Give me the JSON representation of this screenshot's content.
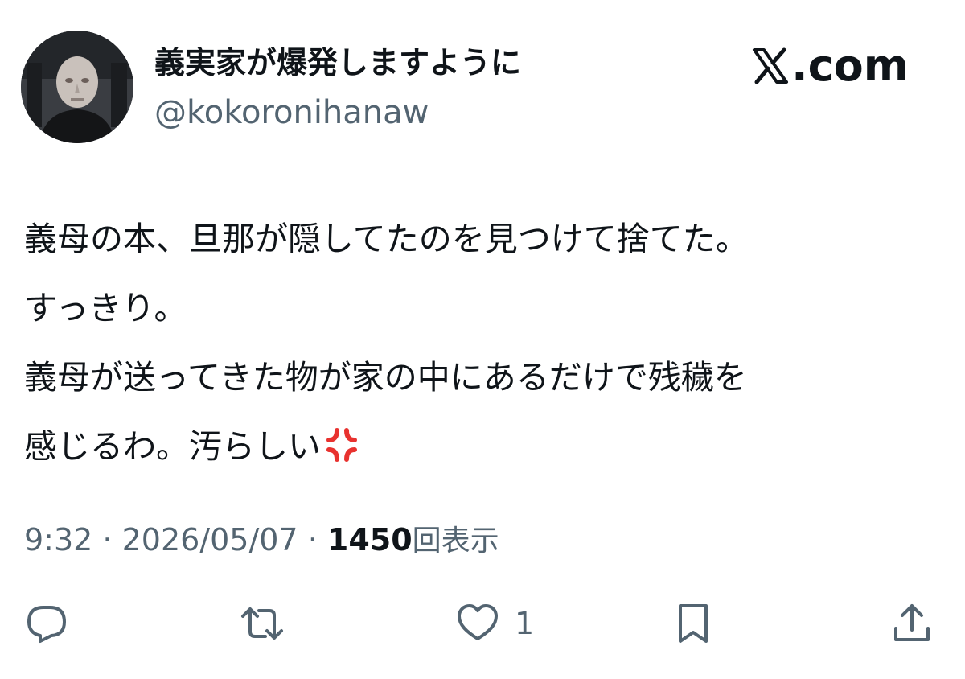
{
  "header": {
    "display_name": "義実家が爆発しますように",
    "handle": "@kokoronihanaw",
    "brand": ".com",
    "brand_icon": "x-logo"
  },
  "tweet": {
    "lines": [
      "義母の本、旦那が隠してたのを見つけて捨てた。",
      "すっきり。",
      "義母が送ってきた物が家の中にあるだけで残穢を",
      "感じるわ。汚らしい"
    ],
    "emoji": "anger-symbol"
  },
  "meta": {
    "time": "9:32",
    "separator": " · ",
    "date": "2026/05/07",
    "views_count": "1450",
    "views_label": "回表示"
  },
  "actions": {
    "reply_icon": "reply-icon",
    "repost_icon": "repost-icon",
    "like_icon": "heart-icon",
    "like_count": "1",
    "bookmark_icon": "bookmark-icon",
    "share_icon": "share-icon"
  },
  "colors": {
    "text_primary": "#0f1419",
    "text_secondary": "#536471",
    "anger_red": "#e8322f"
  }
}
